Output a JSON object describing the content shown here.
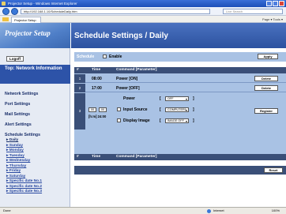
{
  "browser": {
    "window_title": "Projector Setup - Windows Internet Explorer",
    "url": "http://192.168.1.10/ScheduleDaily.htm",
    "search_placeholder": "Live Search",
    "tab_label": "Projector Setup",
    "tools_label": "Page ▾  Tools ▾"
  },
  "sidebar": {
    "logo_text": "Projector Setup",
    "logout_label": "Logoff",
    "top_section": "Top: Network Information",
    "links": [
      "Network Settings",
      "Port Settings",
      "Mail Settings",
      "Alert Settings",
      "Schedule Settings"
    ],
    "schedule_items": [
      "Daily",
      "Sunday",
      "Monday",
      "Tuesday",
      "Wednesday",
      "Thursday",
      "Friday",
      "Saturday",
      "Specific date No.1",
      "Specific date No.2",
      "Specific date No.3"
    ]
  },
  "main": {
    "page_title": "Schedule Settings / Daily",
    "schedule_label": "Schedule",
    "enable_label": "Enable",
    "apply_label": "Apply",
    "col_number": "#",
    "col_time": "Time",
    "col_command": "Command [Parameter]",
    "rows": [
      {
        "num": "1",
        "time": "08:00",
        "command": "Power [ON]",
        "action": "Delete"
      },
      {
        "num": "2",
        "time": "17:00",
        "command": "Power [OFF]",
        "action": "Delete"
      }
    ],
    "edit_row": {
      "num": "3",
      "hour": "00",
      "minute": "00",
      "format": "[h:m] 24:00",
      "commands": [
        {
          "label": "Power",
          "value": "OFF"
        },
        {
          "label": "Input Source",
          "value": "COMPUTER1"
        },
        {
          "label": "Display Image",
          "value": "IMAGE OFF"
        }
      ],
      "register_label": "Register"
    },
    "reset_label": "Reset"
  },
  "statusbar": {
    "status_text": "Done",
    "zone_text": "Internet",
    "zoom_text": "100%"
  }
}
